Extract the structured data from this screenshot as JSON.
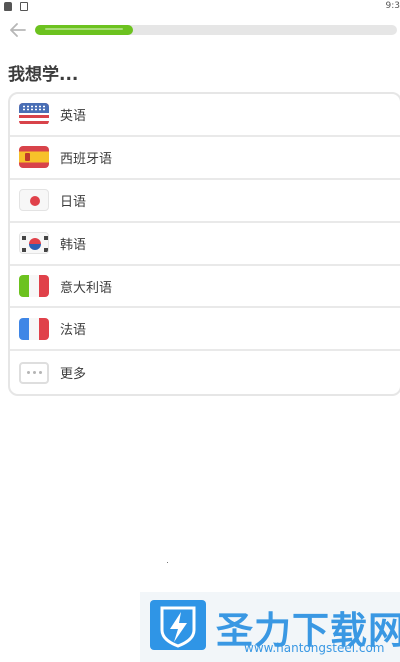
{
  "status_bar": {
    "time": "9:3",
    "icons": [
      "notification-icon",
      "app-icon"
    ]
  },
  "top_bar": {
    "back_icon": "arrow-left-icon",
    "progress": 0.27,
    "progress_color": "#6cc21f"
  },
  "prompt": {
    "title": "我想学..."
  },
  "languages": {
    "items": [
      {
        "label": "英语",
        "icon": "us-flag-icon"
      },
      {
        "label": "西班牙语",
        "icon": "spain-flag-icon"
      },
      {
        "label": "日语",
        "icon": "japan-flag-icon"
      },
      {
        "label": "韩语",
        "icon": "korea-flag-icon"
      },
      {
        "label": "意大利语",
        "icon": "italy-flag-icon"
      },
      {
        "label": "法语",
        "icon": "france-flag-icon"
      },
      {
        "label": "更多",
        "icon": "more-dots-icon"
      }
    ]
  },
  "watermark": {
    "title": "圣力下载网",
    "url": "www.hantongsteel.com",
    "icon": "lightning-shield-icon",
    "color": "#3a98e3"
  }
}
